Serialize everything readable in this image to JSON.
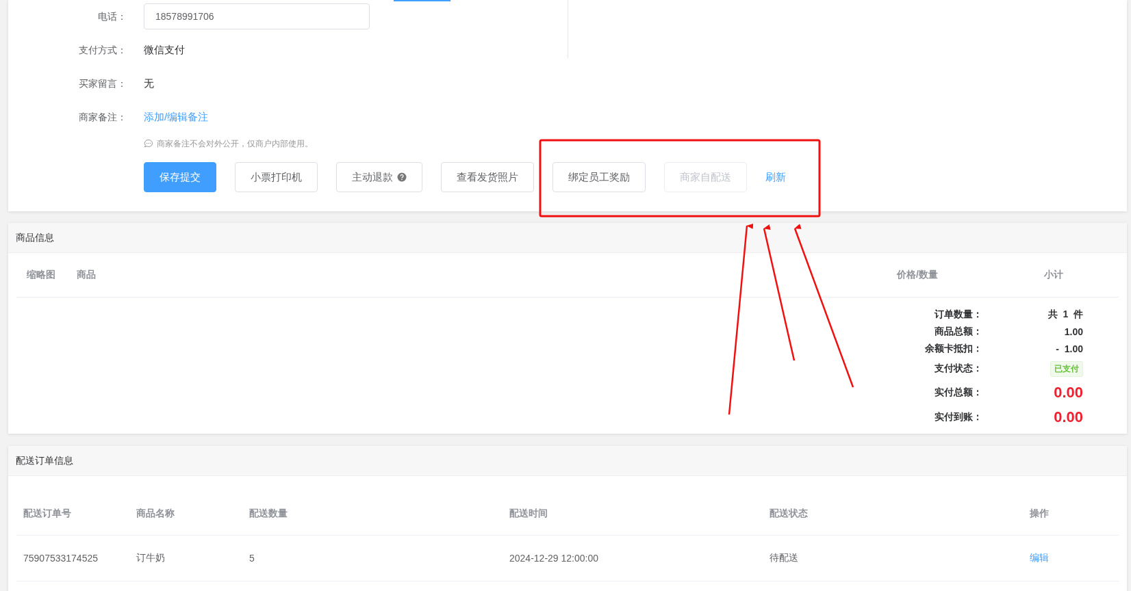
{
  "order_info": {
    "fields": [
      {
        "label": "电话：",
        "kind": "input",
        "value": "18578991706"
      },
      {
        "label": "支付方式：",
        "kind": "text",
        "value": "微信支付"
      },
      {
        "label": "买家留言：",
        "kind": "text",
        "value": "无"
      },
      {
        "label": "商家备注：",
        "kind": "link",
        "value": "添加/编辑备注"
      }
    ],
    "hint": "商家备注不会对外公开，仅商户内部使用。",
    "buttons": [
      {
        "label": "保存提交",
        "kind": "primary",
        "help": false
      },
      {
        "label": "小票打印机",
        "kind": "default",
        "help": false
      },
      {
        "label": "主动退款",
        "kind": "default",
        "help": true
      },
      {
        "label": "查看发货照片",
        "kind": "default",
        "help": false
      },
      {
        "label": "绑定员工奖励",
        "kind": "default",
        "help": false
      },
      {
        "label": "商家自配送",
        "kind": "disabled",
        "help": false
      },
      {
        "label": "刷新",
        "kind": "link",
        "help": false
      }
    ]
  },
  "goods": {
    "title": "商品信息",
    "columns": [
      "缩略图",
      "商品",
      "价格/数量",
      "小计"
    ],
    "summary": [
      {
        "label": "订单数量：",
        "value": "共  1  件",
        "kind": "plain"
      },
      {
        "label": "商品总额：",
        "value": "1.00",
        "kind": "plain"
      },
      {
        "label": "余额卡抵扣：",
        "value": "-  1.00",
        "kind": "plain"
      },
      {
        "label": "支付状态：",
        "value": "已支付",
        "kind": "tag"
      },
      {
        "label": "实付总额：",
        "value": "0.00",
        "kind": "big"
      },
      {
        "label": "实付到账：",
        "value": "0.00",
        "kind": "big"
      }
    ]
  },
  "delivery": {
    "title": "配送订单信息",
    "columns": [
      "配送订单号",
      "商品名称",
      "配送数量",
      "配送时间",
      "配送状态",
      "操作"
    ],
    "rows": [
      [
        "75907533174525",
        "订牛奶",
        "5",
        "2024-12-29 12:00:00",
        "待配送",
        "编辑"
      ]
    ]
  }
}
